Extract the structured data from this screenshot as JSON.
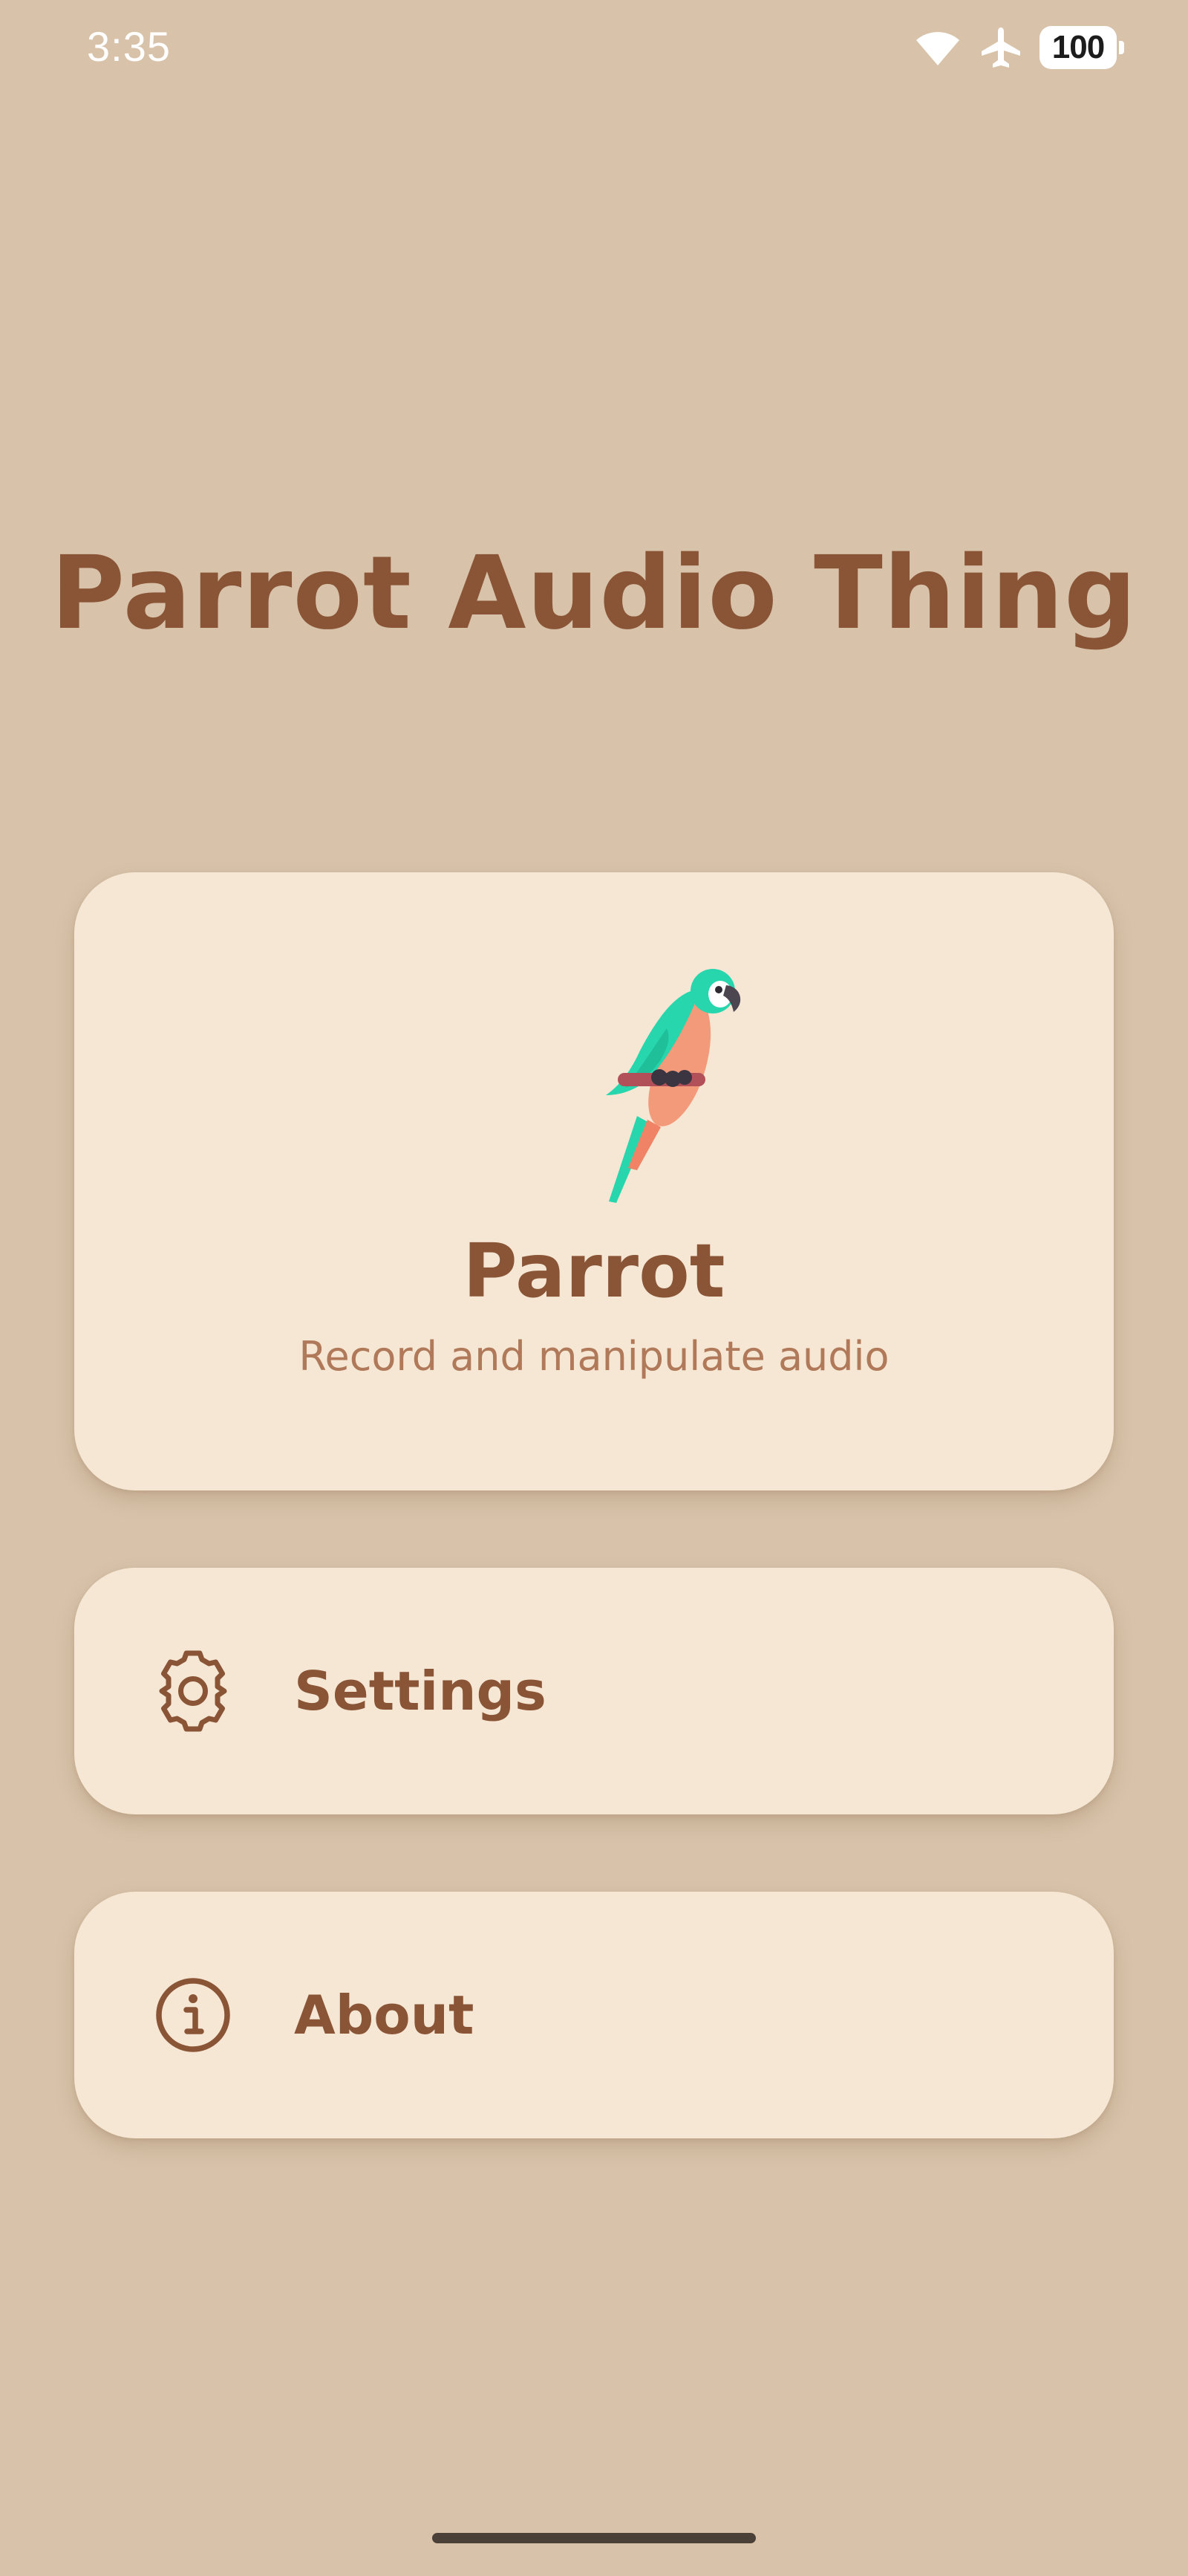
{
  "status_bar": {
    "time": "3:35",
    "battery": "100",
    "icons": [
      "wifi-icon",
      "airplane-mode-icon",
      "battery-icon"
    ]
  },
  "app": {
    "title": "Parrot Audio Thing"
  },
  "cards": {
    "parrot": {
      "title": "Parrot",
      "subtitle": "Record and manipulate audio",
      "icon": "parrot-illustration"
    },
    "settings": {
      "label": "Settings",
      "icon": "gear-icon"
    },
    "about": {
      "label": "About",
      "icon": "info-icon"
    }
  },
  "colors": {
    "background": "#d8c3aa",
    "card": "#f6e7d5",
    "accent": "#8a5537",
    "subtitle": "#b07a5a"
  }
}
